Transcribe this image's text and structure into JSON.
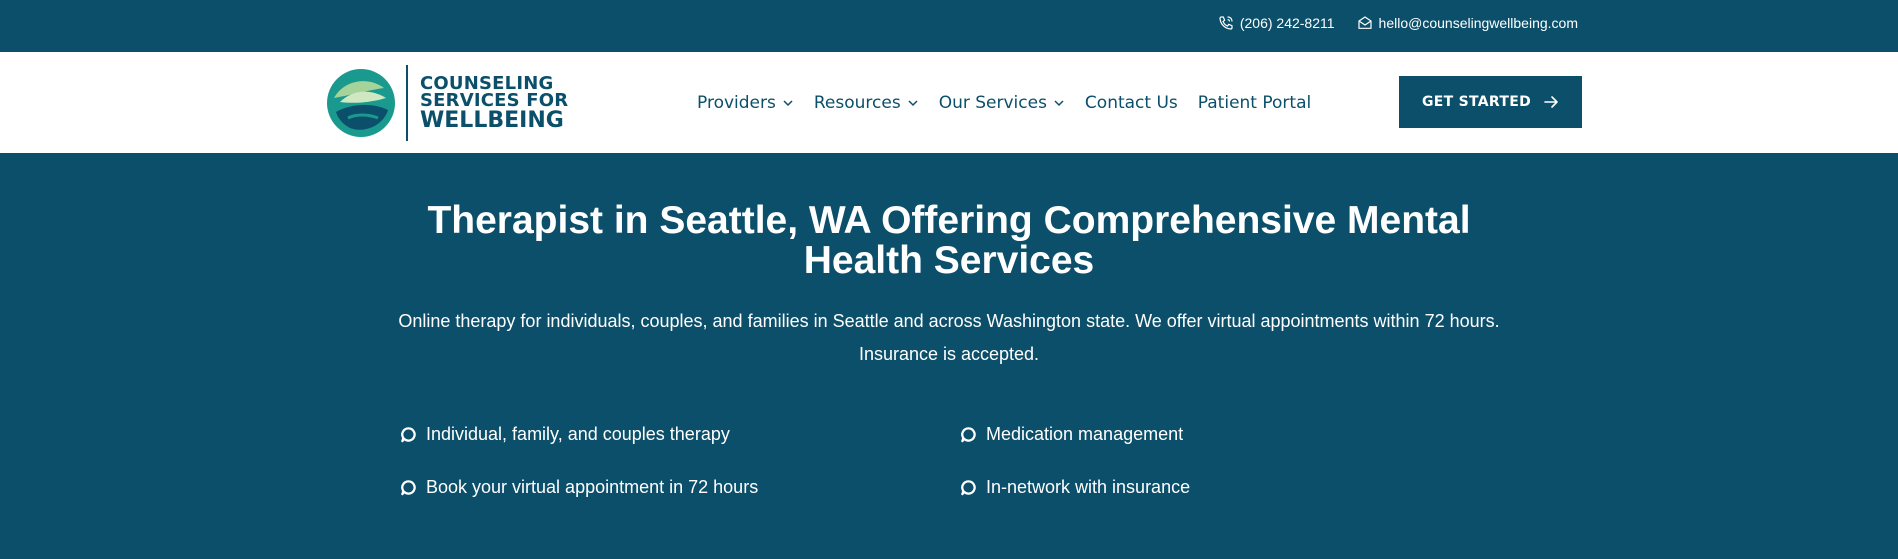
{
  "topbar": {
    "phone": "(206) 242-8211",
    "email": "hello@counselingwellbeing.com",
    "phone_icon": "phone-icon",
    "email_icon": "envelope-icon"
  },
  "header": {
    "logo": {
      "line1": "COUNSELING",
      "line2": "SERVICES FOR",
      "line3": "WELLBEING"
    },
    "nav": [
      {
        "label": "Providers",
        "has_dropdown": true
      },
      {
        "label": "Resources",
        "has_dropdown": true
      },
      {
        "label": "Our Services",
        "has_dropdown": true
      },
      {
        "label": "Contact Us",
        "has_dropdown": false
      },
      {
        "label": "Patient Portal",
        "has_dropdown": false
      }
    ],
    "cta_label": "GET STARTED"
  },
  "hero": {
    "title_line1": "Therapist in Seattle, WA Offering Comprehensive Mental",
    "title_line2": "Health Services",
    "subtitle_line1": "Online therapy for individuals, couples, and families in Seattle and across Washington state. We offer virtual appointments within 72 hours.",
    "subtitle_line2": "Insurance is accepted.",
    "features": [
      "Individual, family, and couples therapy",
      "Medication management",
      "Book your virtual appointment in 72 hours",
      "In-network with insurance"
    ]
  },
  "colors": {
    "primary": "#0b4f6a",
    "white": "#ffffff",
    "logo_teal": "#1a9a8f",
    "logo_light_green": "#a6d39a"
  }
}
